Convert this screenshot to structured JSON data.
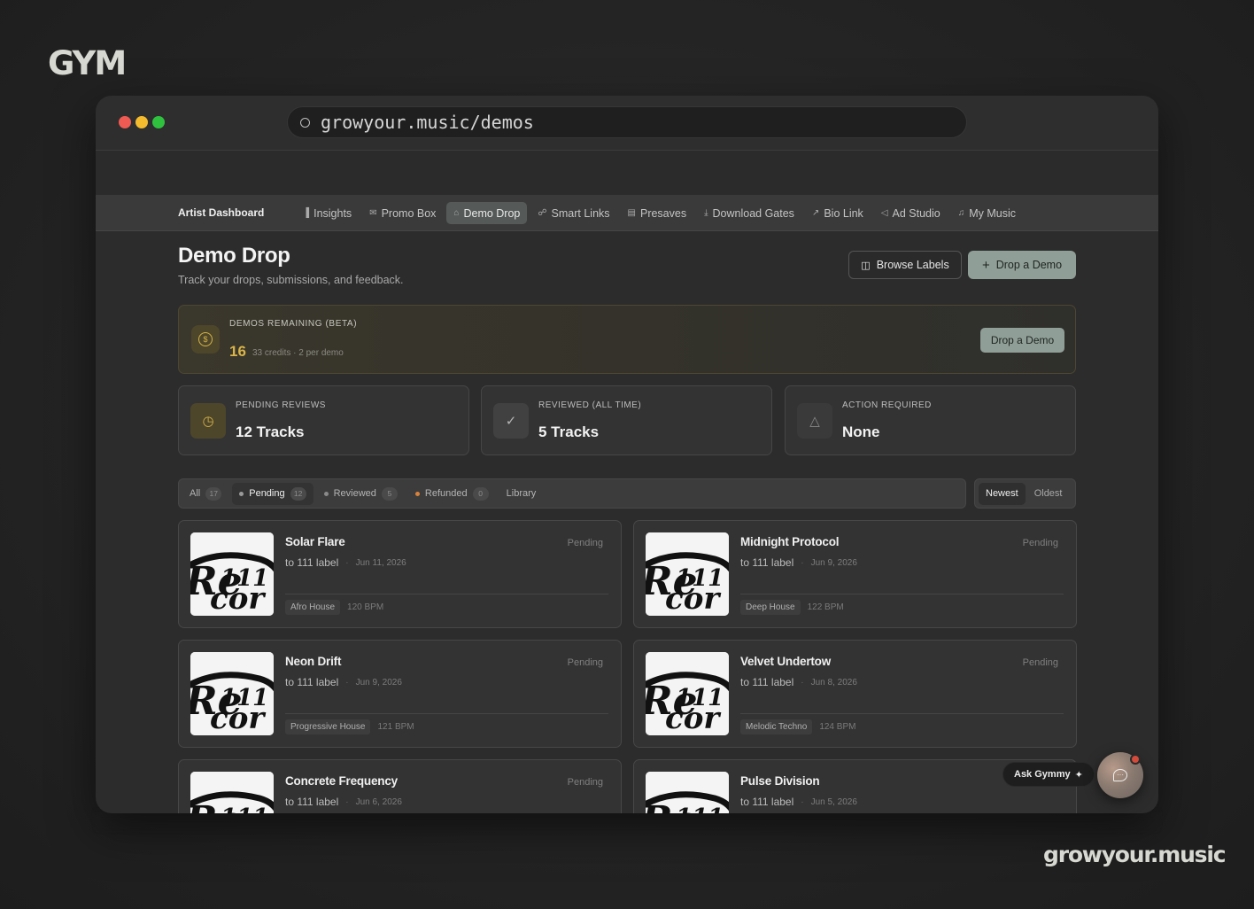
{
  "brand": {
    "logo": "GYM",
    "footer": "growyour.music"
  },
  "browser": {
    "url": "growyour.music/demos",
    "traffic_lights": [
      "#ef5a52",
      "#f5bb2e",
      "#2fc23f"
    ]
  },
  "nav": {
    "brand": "Artist Dashboard",
    "tabs": [
      {
        "label": "Insights",
        "icon": "chart-icon"
      },
      {
        "label": "Promo Box",
        "icon": "mail-icon"
      },
      {
        "label": "Demo Drop",
        "icon": "home-icon",
        "active": true
      },
      {
        "label": "Smart Links",
        "icon": "link-icon"
      },
      {
        "label": "Presaves",
        "icon": "calendar-icon"
      },
      {
        "label": "Download Gates",
        "icon": "download-icon"
      },
      {
        "label": "Bio Link",
        "icon": "external-icon"
      },
      {
        "label": "Ad Studio",
        "icon": "megaphone-icon"
      },
      {
        "label": "My Music",
        "icon": "music-icon"
      }
    ]
  },
  "page": {
    "title": "Demo Drop",
    "subtitle": "Track your drops, submissions, and feedback.",
    "browse_labels": "Browse Labels",
    "drop_demo": "Drop a Demo"
  },
  "credits": {
    "label": "DEMOS REMAINING (BETA)",
    "remaining": "16",
    "detail": "33 credits · 2 per demo",
    "button": "Drop a Demo"
  },
  "stats": [
    {
      "label": "PENDING REVIEWS",
      "value": "12 Tracks",
      "icon": "clock-icon",
      "color": "#d6b347"
    },
    {
      "label": "REVIEWED (ALL TIME)",
      "value": "5 Tracks",
      "icon": "check-circle-icon",
      "color": "#a5a5a5"
    },
    {
      "label": "ACTION REQUIRED",
      "value": "None",
      "icon": "warning-icon",
      "color": "#8a8a8a"
    }
  ],
  "filters": [
    {
      "label": "All",
      "count": "17"
    },
    {
      "label": "Pending",
      "count": "12",
      "active": true,
      "dot": "#9a9a9a"
    },
    {
      "label": "Reviewed",
      "count": "5",
      "dot": "#8a8a8a"
    },
    {
      "label": "Refunded",
      "count": "0",
      "dot": "#d9823b"
    },
    {
      "label": "Library"
    }
  ],
  "sort": [
    {
      "label": "Newest",
      "active": true
    },
    {
      "label": "Oldest"
    }
  ],
  "tracks": [
    {
      "title": "Solar Flare",
      "label": "to 111 label",
      "date": "Jun 11, 2026",
      "status": "Pending",
      "genre": "Afro House",
      "bpm": "120 BPM"
    },
    {
      "title": "Midnight Protocol",
      "label": "to 111 label",
      "date": "Jun 9, 2026",
      "status": "Pending",
      "genre": "Deep House",
      "bpm": "122 BPM"
    },
    {
      "title": "Neon Drift",
      "label": "to 111 label",
      "date": "Jun 9, 2026",
      "status": "Pending",
      "genre": "Progressive House",
      "bpm": "121 BPM"
    },
    {
      "title": "Velvet Undertow",
      "label": "to 111 label",
      "date": "Jun 8, 2026",
      "status": "Pending",
      "genre": "Melodic Techno",
      "bpm": "124 BPM"
    },
    {
      "title": "Concrete Frequency",
      "label": "to 111 label",
      "date": "Jun 6, 2026",
      "status": "Pending",
      "genre": "",
      "bpm": ""
    },
    {
      "title": "Pulse Division",
      "label": "to 111 label",
      "date": "Jun 5, 2026",
      "status": "",
      "genre": "",
      "bpm": ""
    }
  ],
  "assistant": {
    "label": "Ask Gymmy"
  }
}
